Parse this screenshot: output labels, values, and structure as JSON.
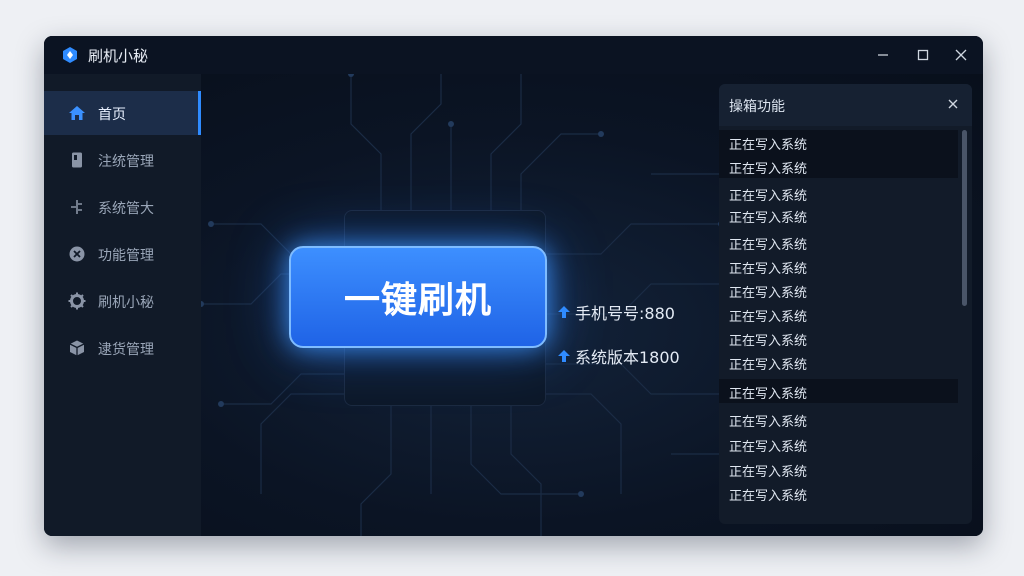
{
  "window": {
    "title": "刷机小秘"
  },
  "sidebar": {
    "items": [
      {
        "label": "首页",
        "icon": "home-icon",
        "active": true
      },
      {
        "label": "注统管理",
        "icon": "phone-icon"
      },
      {
        "label": "系统管大",
        "icon": "tool-icon"
      },
      {
        "label": "功能管理",
        "icon": "function-icon"
      },
      {
        "label": "刷机小秘",
        "icon": "gear-icon"
      },
      {
        "label": "逮货管理",
        "icon": "box-icon"
      }
    ]
  },
  "main": {
    "flash_button": "一键刷机",
    "info": [
      {
        "text": "手机号号:880"
      },
      {
        "text": "系统版本1800"
      }
    ]
  },
  "panel": {
    "title": "操箱功能",
    "logs": [
      "正在写入系统",
      "正在写入系统",
      "正在写入系统",
      "正在写入系统",
      "正在写入系统",
      "正在写入系统",
      "正在写入系统",
      "正在写入系统",
      "正在写入系统",
      "正在写入系统",
      "正在写入系统",
      "正在写入系统",
      "正在写入系统",
      "正在写入系统",
      "正在写入系统"
    ]
  },
  "colors": {
    "accent": "#2f8bff",
    "background": "#0a1220",
    "button": "#1f63e6"
  }
}
